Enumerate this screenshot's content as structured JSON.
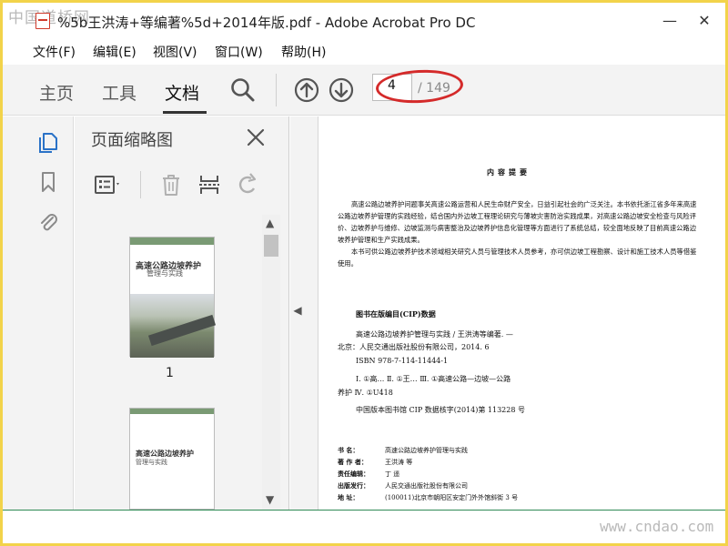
{
  "watermarks": {
    "top": "中国道桥网",
    "bottom": "www.cndao.com"
  },
  "window": {
    "title": "%5b王洪涛+等编著%5d+2014年版.pdf - Adobe Acrobat Pro DC",
    "minimize": "—",
    "close": "✕"
  },
  "menu": [
    "文件(F)",
    "编辑(E)",
    "视图(V)",
    "窗口(W)",
    "帮助(H)"
  ],
  "toolbar": {
    "tabs": [
      "主页",
      "工具",
      "文档"
    ],
    "active_tab": "文档",
    "current_page": "4",
    "total_pages": "/ 149",
    "highlight_color": "#d42a2a"
  },
  "thumbnails_panel": {
    "title": "页面缩略图",
    "page1_label": "1",
    "page1": {
      "title": "高速公路边坡养护",
      "subtitle": "管理与实践"
    },
    "page2": {
      "title": "高速公路边坡养护",
      "subtitle": "管理与实践"
    }
  },
  "document": {
    "heading": "内容提要",
    "para1": "高速公路边坡养护问题事关高速公路运营和人民生命财产安全，日益引起社会的广泛关注。本书依托浙江省多年来高速公路边坡养护管理的实践经验，结合国内外边坡工程理论研究与薄坡灾害防治实践成果，对高速公路边坡安全检查与风险评价、边坡养护与维修、边坡监测与病害整治及边坡养护信息化管理等方面进行了系统总结，较全面地反映了目前高速公路边坡养护管理和生产实践成果。",
    "para2": "本书可供公路边坡养护技术领域相关研究人员与管理技术人员参考，亦可供边坡工程勘察、设计和施工技术人员等借鉴使用。",
    "cip_title": "图书在版编目(CIP)数据",
    "cip_lines": [
      "高速公路边坡养护管理与实践 / 王洪涛等编著. —",
      "北京：人民交通出版社股份有限公司，2014. 6",
      "ISBN  978-7-114-11444-1",
      "Ⅰ. ①高…  Ⅱ. ①王…  Ⅲ. ①高速公路—边坡—公路",
      "养护  Ⅳ. ①U418",
      "中国版本图书馆 CIP 数据核字(2014)第 113228 号"
    ],
    "book_info": [
      {
        "label": "书     名：",
        "value": "高速公路边坡养护管理与实践"
      },
      {
        "label": "著 作 者：",
        "value": "王洪涛  等"
      },
      {
        "label": "责任编辑：",
        "value": "丁  遥"
      },
      {
        "label": "出版发行：",
        "value": "人民交通出版社股份有限公司"
      },
      {
        "label": "地     址：",
        "value": "(100011)北京市朝阳区安定门外外馆斜街 3 号"
      }
    ]
  }
}
